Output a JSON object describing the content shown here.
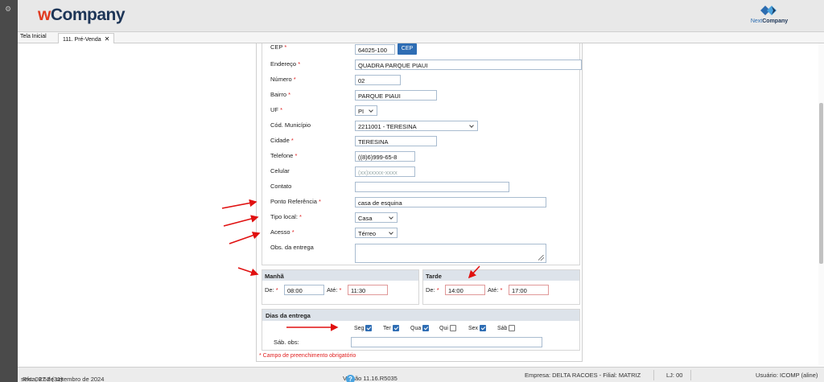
{
  "app": {
    "brand_prefix": "w",
    "brand_rest": "Company",
    "partner_logo_a": "Next",
    "partner_logo_b": "Company"
  },
  "tabs": [
    {
      "label": "Tela Inicial"
    },
    {
      "label": "111. Pré-Venda",
      "close": "✕"
    }
  ],
  "form": {
    "cep": {
      "label": "CEP",
      "value": "64025-100",
      "button": "CEP"
    },
    "endereco": {
      "label": "Endereço",
      "value": "QUADRA PARQUE PIAUI"
    },
    "numero": {
      "label": "Número",
      "value": "02"
    },
    "bairro": {
      "label": "Bairro",
      "value": "PARQUE PIAUI"
    },
    "uf": {
      "label": "UF",
      "value": "PI"
    },
    "cod_municipio": {
      "label": "Cód. Município",
      "value": "2211001 - TERESINA"
    },
    "cidade": {
      "label": "Cidade",
      "value": "TERESINA"
    },
    "telefone": {
      "label": "Telefone",
      "value": "((8)6)999-65-8"
    },
    "celular": {
      "label": "Celular",
      "placeholder": "(xx)xxxxx-xxxx"
    },
    "contato": {
      "label": "Contato",
      "value": ""
    },
    "ponto_referencia": {
      "label": "Ponto Referência",
      "value": "casa de esquina"
    },
    "tipo_local": {
      "label": "Tipo local:",
      "value": "Casa"
    },
    "acesso": {
      "label": "Acesso",
      "value": "Térreo"
    },
    "obs_entrega": {
      "label": "Obs. da entrega",
      "value": ""
    },
    "req_mark": "*"
  },
  "manha": {
    "title": "Manhã",
    "de_label": "De:",
    "de_value": "08:00",
    "ate_label": "Até:",
    "ate_value": "11:30"
  },
  "tarde": {
    "title": "Tarde",
    "de_label": "De:",
    "de_value": "14:00",
    "ate_label": "Até:",
    "ate_value": "17:00"
  },
  "dias": {
    "title": "Dias da entrega",
    "items": [
      {
        "label": "Seg",
        "checked": true
      },
      {
        "label": "Ter",
        "checked": true
      },
      {
        "label": "Qua",
        "checked": true
      },
      {
        "label": "Qui",
        "checked": false
      },
      {
        "label": "Sex",
        "checked": true
      },
      {
        "label": "Sáb",
        "checked": false
      }
    ],
    "sab_obs_label": "Sáb. obs:"
  },
  "required_note": "* Campo de preenchimento obrigatório",
  "status": {
    "date": "sexta, 27 de setembro de 2024",
    "rfs": "Rfs: 08:52 (31)",
    "version": "Versão 11.16.R5035",
    "help": "?",
    "empresa": "Empresa: DELTA RACOES - Filial: MATRIZ",
    "lj": "LJ: 00",
    "usuario": "Usuário: ICOMP (aline)"
  },
  "colors": {
    "accent": "#2e6db4",
    "brand_red": "#e03a20",
    "brand_navy": "#1d3557",
    "required": "#e02020",
    "annotation_arrow": "#e01010"
  }
}
